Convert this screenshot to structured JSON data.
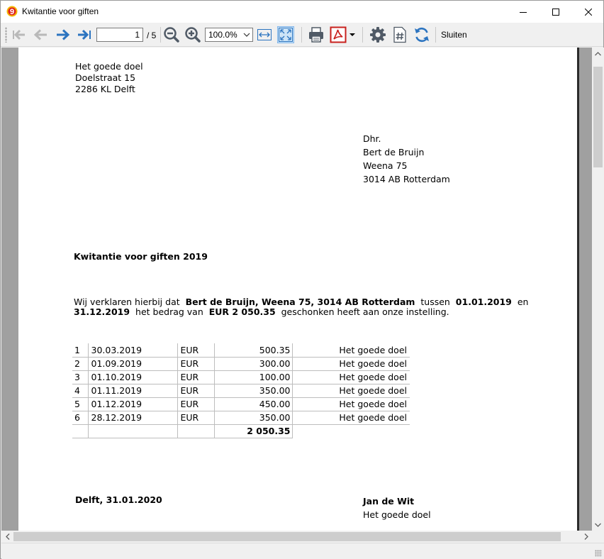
{
  "window": {
    "title": "Kwitantie voor giften",
    "icon": "app-logo-icon"
  },
  "toolbar": {
    "page_current": "1",
    "page_total": "/ 5",
    "zoom": "100.0%",
    "close_label": "Sluiten",
    "icons": [
      "first-page-icon",
      "previous-page-icon",
      "next-page-icon",
      "last-page-icon",
      "zoom-out-icon",
      "zoom-in-icon",
      "fit-width-icon",
      "fit-page-icon",
      "print-icon",
      "pdf-icon",
      "settings-icon",
      "page-number-icon",
      "refresh-icon"
    ]
  },
  "document": {
    "sender": {
      "line1": "Het goede doel",
      "line2": "Doelstraat 15",
      "line3": "2286 KL Delft"
    },
    "recipient": {
      "salutation": "Dhr.",
      "name": "Bert de Bruijn",
      "street": "Weena 75",
      "city": "3014 AB Rotterdam"
    },
    "heading": "Kwitantie voor giften 2019",
    "statement": {
      "part1": "Wij verklaren hierbij dat",
      "donor": "Bert de Bruijn, Weena 75, 3014 AB Rotterdam",
      "part2": "tussen",
      "date_from": "01.01.2019",
      "part3": "en",
      "date_to": "31.12.2019",
      "part4": "het bedrag van",
      "amount": "EUR 2 050.35",
      "part5": "geschonken heeft aan onze instelling."
    },
    "gifts": [
      {
        "nr": "1",
        "date": "30.03.2019",
        "currency": "EUR",
        "amount": "500.35",
        "organisation": "Het goede doel"
      },
      {
        "nr": "2",
        "date": "01.09.2019",
        "currency": "EUR",
        "amount": "300.00",
        "organisation": "Het goede doel"
      },
      {
        "nr": "3",
        "date": "01.10.2019",
        "currency": "EUR",
        "amount": "100.00",
        "organisation": "Het goede doel"
      },
      {
        "nr": "4",
        "date": "01.11.2019",
        "currency": "EUR",
        "amount": "350.00",
        "organisation": "Het goede doel"
      },
      {
        "nr": "5",
        "date": "01.12.2019",
        "currency": "EUR",
        "amount": "450.00",
        "organisation": "Het goede doel"
      },
      {
        "nr": "6",
        "date": "28.12.2019",
        "currency": "EUR",
        "amount": "350.00",
        "organisation": "Het goede doel"
      }
    ],
    "total": "2 050.35",
    "place_date": "Delft, 31.01.2020",
    "signatory": {
      "name": "Jan de Wit",
      "organisation": "Het goede doel"
    }
  }
}
